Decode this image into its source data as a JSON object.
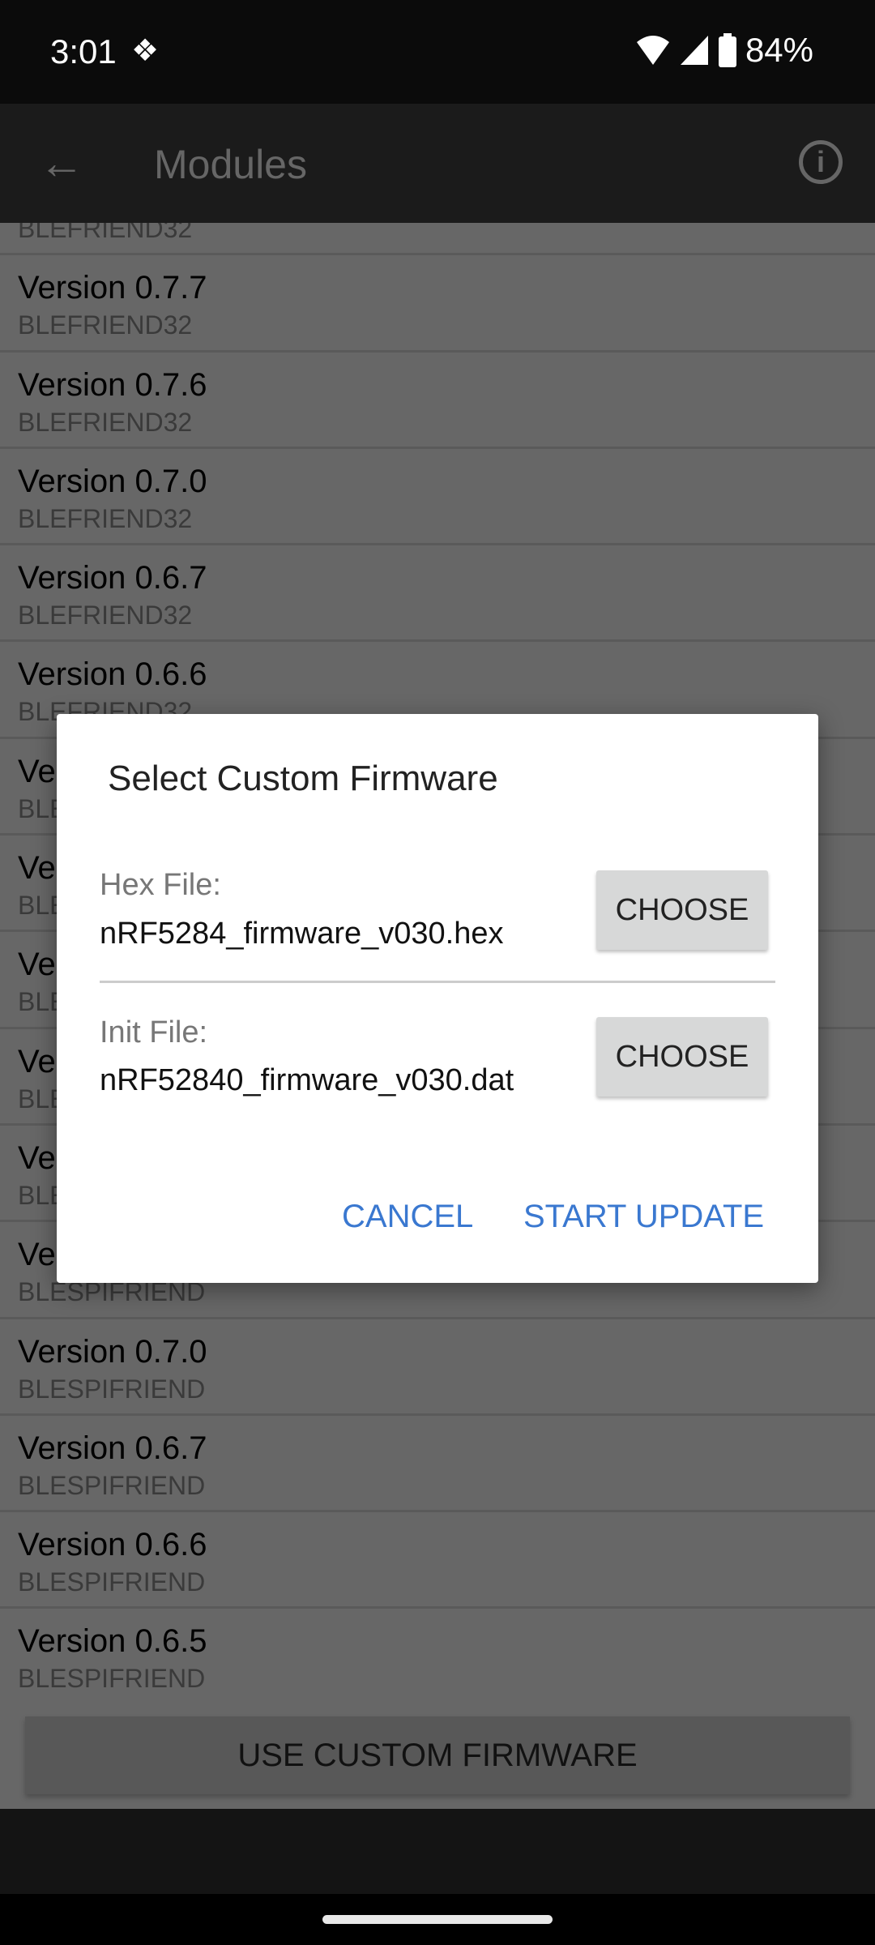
{
  "status_bar": {
    "time": "3:01",
    "battery": "84%",
    "icons": [
      "dropbox-icon",
      "wifi-icon",
      "signal-icon",
      "battery-icon"
    ]
  },
  "toolbar": {
    "title": "Modules",
    "back_icon": "arrow-left-icon",
    "info_icon": "info-icon"
  },
  "list": [
    {
      "title": "",
      "subtitle": "BLEFRIEND32"
    },
    {
      "title": "Version 0.7.7",
      "subtitle": "BLEFRIEND32"
    },
    {
      "title": "Version 0.7.6",
      "subtitle": "BLEFRIEND32"
    },
    {
      "title": "Version 0.7.0",
      "subtitle": "BLEFRIEND32"
    },
    {
      "title": "Version 0.6.7",
      "subtitle": "BLEFRIEND32"
    },
    {
      "title": "Version 0.6.6",
      "subtitle": "BLEFRIEND32"
    },
    {
      "title": "Ve",
      "subtitle": "BLE"
    },
    {
      "title": "Ve",
      "subtitle": "BLE"
    },
    {
      "title": "Ve",
      "subtitle": "BLE"
    },
    {
      "title": "Ve",
      "subtitle": "BLE"
    },
    {
      "title": "Ve",
      "subtitle": "BLE"
    },
    {
      "title": "Ve",
      "subtitle": "BLESPIFRIEND"
    },
    {
      "title": "Version 0.7.0",
      "subtitle": "BLESPIFRIEND"
    },
    {
      "title": "Version 0.6.7",
      "subtitle": "BLESPIFRIEND"
    },
    {
      "title": "Version 0.6.6",
      "subtitle": "BLESPIFRIEND"
    },
    {
      "title": "Version 0.6.5",
      "subtitle": "BLESPIFRIEND"
    }
  ],
  "bottom_button": "USE CUSTOM FIRMWARE",
  "dialog": {
    "title": "Select Custom Firmware",
    "hex_label": "Hex File:",
    "hex_value": "nRF5284_firmware_v030.hex",
    "init_label": "Init File:",
    "init_value": "nRF52840_firmware_v030.dat",
    "choose": "CHOOSE",
    "cancel": "CANCEL",
    "start": "START UPDATE",
    "accent": "#3a78d0"
  }
}
